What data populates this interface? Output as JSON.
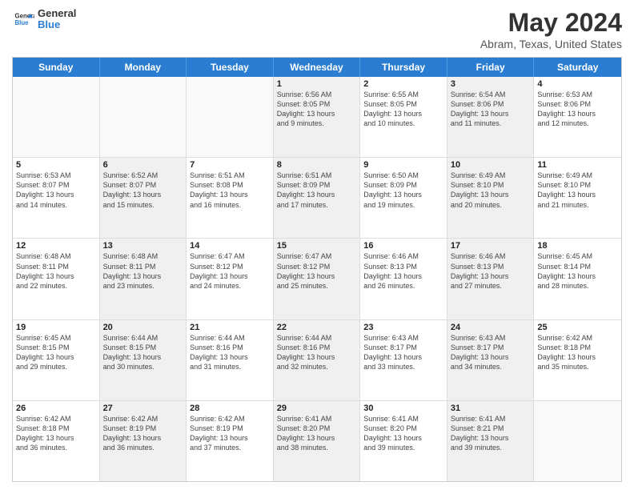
{
  "header": {
    "logo_line1": "General",
    "logo_line2": "Blue",
    "title": "May 2024",
    "subtitle": "Abram, Texas, United States"
  },
  "weekdays": [
    "Sunday",
    "Monday",
    "Tuesday",
    "Wednesday",
    "Thursday",
    "Friday",
    "Saturday"
  ],
  "rows": [
    [
      {
        "day": "",
        "info": "",
        "empty": true
      },
      {
        "day": "",
        "info": "",
        "empty": true
      },
      {
        "day": "",
        "info": "",
        "empty": true
      },
      {
        "day": "1",
        "info": "Sunrise: 6:56 AM\nSunset: 8:05 PM\nDaylight: 13 hours\nand 9 minutes.",
        "shaded": true
      },
      {
        "day": "2",
        "info": "Sunrise: 6:55 AM\nSunset: 8:05 PM\nDaylight: 13 hours\nand 10 minutes.",
        "shaded": false
      },
      {
        "day": "3",
        "info": "Sunrise: 6:54 AM\nSunset: 8:06 PM\nDaylight: 13 hours\nand 11 minutes.",
        "shaded": true
      },
      {
        "day": "4",
        "info": "Sunrise: 6:53 AM\nSunset: 8:06 PM\nDaylight: 13 hours\nand 12 minutes.",
        "shaded": false
      }
    ],
    [
      {
        "day": "5",
        "info": "Sunrise: 6:53 AM\nSunset: 8:07 PM\nDaylight: 13 hours\nand 14 minutes.",
        "shaded": false
      },
      {
        "day": "6",
        "info": "Sunrise: 6:52 AM\nSunset: 8:07 PM\nDaylight: 13 hours\nand 15 minutes.",
        "shaded": true
      },
      {
        "day": "7",
        "info": "Sunrise: 6:51 AM\nSunset: 8:08 PM\nDaylight: 13 hours\nand 16 minutes.",
        "shaded": false
      },
      {
        "day": "8",
        "info": "Sunrise: 6:51 AM\nSunset: 8:09 PM\nDaylight: 13 hours\nand 17 minutes.",
        "shaded": true
      },
      {
        "day": "9",
        "info": "Sunrise: 6:50 AM\nSunset: 8:09 PM\nDaylight: 13 hours\nand 19 minutes.",
        "shaded": false
      },
      {
        "day": "10",
        "info": "Sunrise: 6:49 AM\nSunset: 8:10 PM\nDaylight: 13 hours\nand 20 minutes.",
        "shaded": true
      },
      {
        "day": "11",
        "info": "Sunrise: 6:49 AM\nSunset: 8:10 PM\nDaylight: 13 hours\nand 21 minutes.",
        "shaded": false
      }
    ],
    [
      {
        "day": "12",
        "info": "Sunrise: 6:48 AM\nSunset: 8:11 PM\nDaylight: 13 hours\nand 22 minutes.",
        "shaded": false
      },
      {
        "day": "13",
        "info": "Sunrise: 6:48 AM\nSunset: 8:11 PM\nDaylight: 13 hours\nand 23 minutes.",
        "shaded": true
      },
      {
        "day": "14",
        "info": "Sunrise: 6:47 AM\nSunset: 8:12 PM\nDaylight: 13 hours\nand 24 minutes.",
        "shaded": false
      },
      {
        "day": "15",
        "info": "Sunrise: 6:47 AM\nSunset: 8:12 PM\nDaylight: 13 hours\nand 25 minutes.",
        "shaded": true
      },
      {
        "day": "16",
        "info": "Sunrise: 6:46 AM\nSunset: 8:13 PM\nDaylight: 13 hours\nand 26 minutes.",
        "shaded": false
      },
      {
        "day": "17",
        "info": "Sunrise: 6:46 AM\nSunset: 8:13 PM\nDaylight: 13 hours\nand 27 minutes.",
        "shaded": true
      },
      {
        "day": "18",
        "info": "Sunrise: 6:45 AM\nSunset: 8:14 PM\nDaylight: 13 hours\nand 28 minutes.",
        "shaded": false
      }
    ],
    [
      {
        "day": "19",
        "info": "Sunrise: 6:45 AM\nSunset: 8:15 PM\nDaylight: 13 hours\nand 29 minutes.",
        "shaded": false
      },
      {
        "day": "20",
        "info": "Sunrise: 6:44 AM\nSunset: 8:15 PM\nDaylight: 13 hours\nand 30 minutes.",
        "shaded": true
      },
      {
        "day": "21",
        "info": "Sunrise: 6:44 AM\nSunset: 8:16 PM\nDaylight: 13 hours\nand 31 minutes.",
        "shaded": false
      },
      {
        "day": "22",
        "info": "Sunrise: 6:44 AM\nSunset: 8:16 PM\nDaylight: 13 hours\nand 32 minutes.",
        "shaded": true
      },
      {
        "day": "23",
        "info": "Sunrise: 6:43 AM\nSunset: 8:17 PM\nDaylight: 13 hours\nand 33 minutes.",
        "shaded": false
      },
      {
        "day": "24",
        "info": "Sunrise: 6:43 AM\nSunset: 8:17 PM\nDaylight: 13 hours\nand 34 minutes.",
        "shaded": true
      },
      {
        "day": "25",
        "info": "Sunrise: 6:42 AM\nSunset: 8:18 PM\nDaylight: 13 hours\nand 35 minutes.",
        "shaded": false
      }
    ],
    [
      {
        "day": "26",
        "info": "Sunrise: 6:42 AM\nSunset: 8:18 PM\nDaylight: 13 hours\nand 36 minutes.",
        "shaded": false
      },
      {
        "day": "27",
        "info": "Sunrise: 6:42 AM\nSunset: 8:19 PM\nDaylight: 13 hours\nand 36 minutes.",
        "shaded": true
      },
      {
        "day": "28",
        "info": "Sunrise: 6:42 AM\nSunset: 8:19 PM\nDaylight: 13 hours\nand 37 minutes.",
        "shaded": false
      },
      {
        "day": "29",
        "info": "Sunrise: 6:41 AM\nSunset: 8:20 PM\nDaylight: 13 hours\nand 38 minutes.",
        "shaded": true
      },
      {
        "day": "30",
        "info": "Sunrise: 6:41 AM\nSunset: 8:20 PM\nDaylight: 13 hours\nand 39 minutes.",
        "shaded": false
      },
      {
        "day": "31",
        "info": "Sunrise: 6:41 AM\nSunset: 8:21 PM\nDaylight: 13 hours\nand 39 minutes.",
        "shaded": true
      },
      {
        "day": "",
        "info": "",
        "empty": true
      }
    ]
  ]
}
